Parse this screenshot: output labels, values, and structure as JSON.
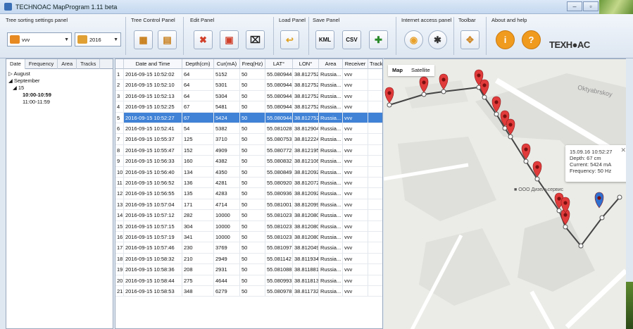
{
  "window": {
    "title": "TECHNOAC MapProgram 1.11 beta",
    "min": "–",
    "max": "▫",
    "close": "✕"
  },
  "toolbar": {
    "groups": {
      "tree_sorting": "Tree sorting settings panel",
      "tree_control": "Tree Control Panel",
      "edit": "Edit Panel",
      "load": "Load Panel",
      "save": "Save Panel",
      "internet": "Internet access panel",
      "toolbar": "Toolbar",
      "about": "About and help"
    },
    "receiver_combo": "vvv",
    "year_combo": "2016",
    "save_kml": "KML",
    "save_csv": "CSV",
    "logo": "TEXH●AC"
  },
  "left": {
    "tabs": [
      "Date",
      "Frequency",
      "Area",
      "Tracks"
    ],
    "tree": [
      {
        "label": "▷ August",
        "indent": 0,
        "bold": false
      },
      {
        "label": "◢ September",
        "indent": 0,
        "bold": false
      },
      {
        "label": "◢ 15",
        "indent": 1,
        "bold": false
      },
      {
        "label": "10:00-10:59",
        "indent": 2,
        "bold": true
      },
      {
        "label": "11:00-11:59",
        "indent": 2,
        "bold": false
      }
    ]
  },
  "table": {
    "columns": [
      "",
      "Date and Time",
      "Depth(cm)",
      "Cur(mA)",
      "Freq(Hz)",
      "LAT°",
      "LON°",
      "Area",
      "Receiver",
      "Trackl"
    ],
    "selected_index": 4,
    "rows": [
      [
        "1",
        "2016-09-15 10:52:02",
        "64",
        "5152",
        "50",
        "55.080944",
        "38.812752",
        "Russia...",
        "vvv"
      ],
      [
        "2",
        "2016-09-15 10:52:10",
        "64",
        "5301",
        "50",
        "55.080944",
        "38.812752",
        "Russia...",
        "vvv"
      ],
      [
        "3",
        "2016-09-15 10:52:13",
        "64",
        "5304",
        "50",
        "55.080944",
        "38.812752",
        "Russia...",
        "vvv"
      ],
      [
        "4",
        "2016-09-15 10:52:25",
        "67",
        "5481",
        "50",
        "55.080944",
        "38.812752",
        "Russia...",
        "vvv"
      ],
      [
        "5",
        "2016-09-15 10:52:27",
        "67",
        "5424",
        "50",
        "55.080944",
        "38.812752",
        "Russia...",
        "vvv"
      ],
      [
        "6",
        "2016-09-15 10:52:41",
        "54",
        "5382",
        "50",
        "55.081028",
        "38.812904",
        "Russia...",
        "vvv"
      ],
      [
        "7",
        "2016-09-15 10:55:37",
        "125",
        "3710",
        "50",
        "55.080753",
        "38.812224",
        "Russia...",
        "vvv"
      ],
      [
        "8",
        "2016-09-15 10:55:47",
        "152",
        "4909",
        "50",
        "55.080772",
        "38.812195",
        "Russia...",
        "vvv"
      ],
      [
        "9",
        "2016-09-15 10:56:33",
        "160",
        "4382",
        "50",
        "55.080832",
        "38.812106",
        "Russia...",
        "vvv"
      ],
      [
        "10",
        "2016-09-15 10:56:40",
        "134",
        "4350",
        "50",
        "55.080849",
        "38.812092",
        "Russia...",
        "vvv"
      ],
      [
        "11",
        "2016-09-15 10:56:52",
        "136",
        "4281",
        "50",
        "55.080920",
        "38.812072",
        "Russia...",
        "vvv"
      ],
      [
        "12",
        "2016-09-15 10:56:55",
        "135",
        "4283",
        "50",
        "55.080936",
        "38.812092",
        "Russia...",
        "vvv"
      ],
      [
        "13",
        "2016-09-15 10:57:04",
        "171",
        "4714",
        "50",
        "55.081001",
        "38.812099",
        "Russia...",
        "vvv"
      ],
      [
        "14",
        "2016-09-15 10:57:12",
        "282",
        "10000",
        "50",
        "55.081023",
        "38.812080",
        "Russia...",
        "vvv"
      ],
      [
        "15",
        "2016-09-15 10:57:15",
        "304",
        "10000",
        "50",
        "55.081023",
        "38.812080",
        "Russia...",
        "vvv"
      ],
      [
        "16",
        "2016-09-15 10:57:19",
        "341",
        "10000",
        "50",
        "55.081023",
        "38.812080",
        "Russia...",
        "vvv"
      ],
      [
        "17",
        "2016-09-15 10:57:46",
        "230",
        "3769",
        "50",
        "55.081097",
        "38.812049",
        "Russia...",
        "vvv"
      ],
      [
        "18",
        "2016-09-15 10:58:32",
        "210",
        "2949",
        "50",
        "55.081142",
        "38.811934",
        "Russia...",
        "vvv"
      ],
      [
        "19",
        "2016-09-15 10:58:36",
        "208",
        "2931",
        "50",
        "55.081088",
        "38.811881",
        "Russia...",
        "vvv"
      ],
      [
        "20",
        "2016-09-15 10:58:44",
        "275",
        "4644",
        "50",
        "55.080993",
        "38.811813",
        "Russia...",
        "vvv"
      ],
      [
        "21",
        "2016-09-15 10:58:53",
        "348",
        "6279",
        "50",
        "55.080978",
        "38.811732",
        "Russia...",
        "vvv"
      ]
    ]
  },
  "map": {
    "type_map": "Map",
    "type_satellite": "Satellite",
    "street": "Oktyabrskoy",
    "poi": "ООО Дизельсервис",
    "info": {
      "line1": "15.09.16 10:52:27",
      "line2": "Depth: 67 cm",
      "line3": "Current: 5424 mA",
      "line4": "Frequency: 50 Hz",
      "close": "✕"
    },
    "colors": {
      "marker": "#e23b3b",
      "selected_marker": "#2f6fd0",
      "track": "#444444"
    }
  }
}
